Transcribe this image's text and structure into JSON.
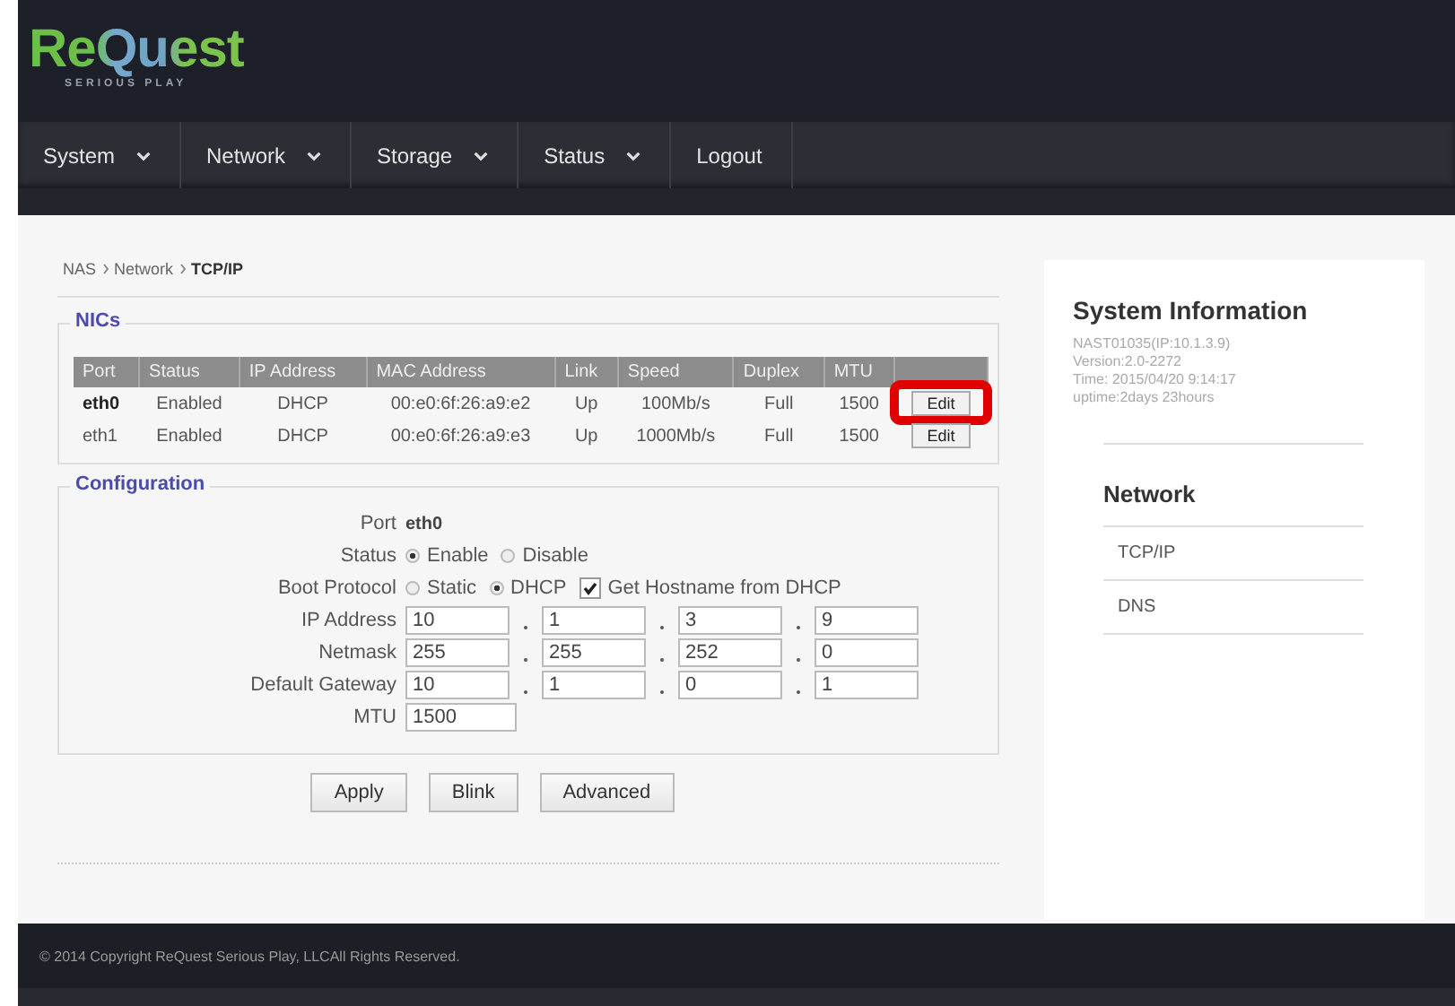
{
  "logo": {
    "name": "ReQuest",
    "tagline": "SERIOUS PLAY"
  },
  "nav": [
    {
      "label": "System",
      "dropdown": true
    },
    {
      "label": "Network",
      "dropdown": true
    },
    {
      "label": "Storage",
      "dropdown": true
    },
    {
      "label": "Status",
      "dropdown": true
    },
    {
      "label": "Logout",
      "dropdown": false
    }
  ],
  "breadcrumb": [
    "NAS",
    "Network",
    "TCP/IP"
  ],
  "nics": {
    "title": "NICs",
    "columns": [
      "Port",
      "Status",
      "IP Address",
      "MAC Address",
      "Link",
      "Speed",
      "Duplex",
      "MTU",
      ""
    ],
    "rows": [
      {
        "port": "eth0",
        "status": "Enabled",
        "ip": "DHCP",
        "mac": "00:e0:6f:26:a9:e2",
        "link": "Up",
        "speed": "100Mb/s",
        "duplex": "Full",
        "mtu": "1500",
        "action": "Edit",
        "selected": true,
        "highlighted": true
      },
      {
        "port": "eth1",
        "status": "Enabled",
        "ip": "DHCP",
        "mac": "00:e0:6f:26:a9:e3",
        "link": "Up",
        "speed": "1000Mb/s",
        "duplex": "Full",
        "mtu": "1500",
        "action": "Edit",
        "selected": false,
        "highlighted": false
      }
    ]
  },
  "configuration": {
    "title": "Configuration",
    "rows": [
      {
        "kind": "text",
        "label": "Port",
        "value": "eth0"
      },
      {
        "kind": "options",
        "label": "Status",
        "options": [
          {
            "kind": "radio",
            "label": "Enable",
            "selected": true
          },
          {
            "kind": "radio",
            "label": "Disable",
            "selected": false
          }
        ]
      },
      {
        "kind": "options",
        "label": "Boot Protocol",
        "options": [
          {
            "kind": "radio",
            "label": "Static",
            "selected": false
          },
          {
            "kind": "radio",
            "label": "DHCP",
            "selected": true
          },
          {
            "kind": "checkbox",
            "label": "Get Hostname from DHCP",
            "checked": true
          }
        ]
      },
      {
        "kind": "octets",
        "label": "IP Address",
        "values": [
          "10",
          "1",
          "3",
          "9"
        ]
      },
      {
        "kind": "octets",
        "label": "Netmask",
        "values": [
          "255",
          "255",
          "252",
          "0"
        ]
      },
      {
        "kind": "octets",
        "label": "Default Gateway",
        "values": [
          "10",
          "1",
          "0",
          "1"
        ]
      },
      {
        "kind": "field",
        "label": "MTU",
        "value": "1500"
      }
    ]
  },
  "buttons": [
    "Apply",
    "Blink",
    "Advanced"
  ],
  "system_info": {
    "title": "System Information",
    "lines": [
      "NAST01035(IP:10.1.3.9)",
      "Version:2.0-2272",
      "Time: 2015/04/20 9:14:17",
      "uptime:2days 23hours"
    ]
  },
  "side_nav": {
    "title": "Network",
    "items": [
      "TCP/IP",
      "DNS"
    ]
  },
  "footer": "© 2014 Copyright ReQuest Serious Play, LLCAll Rights Reserved."
}
